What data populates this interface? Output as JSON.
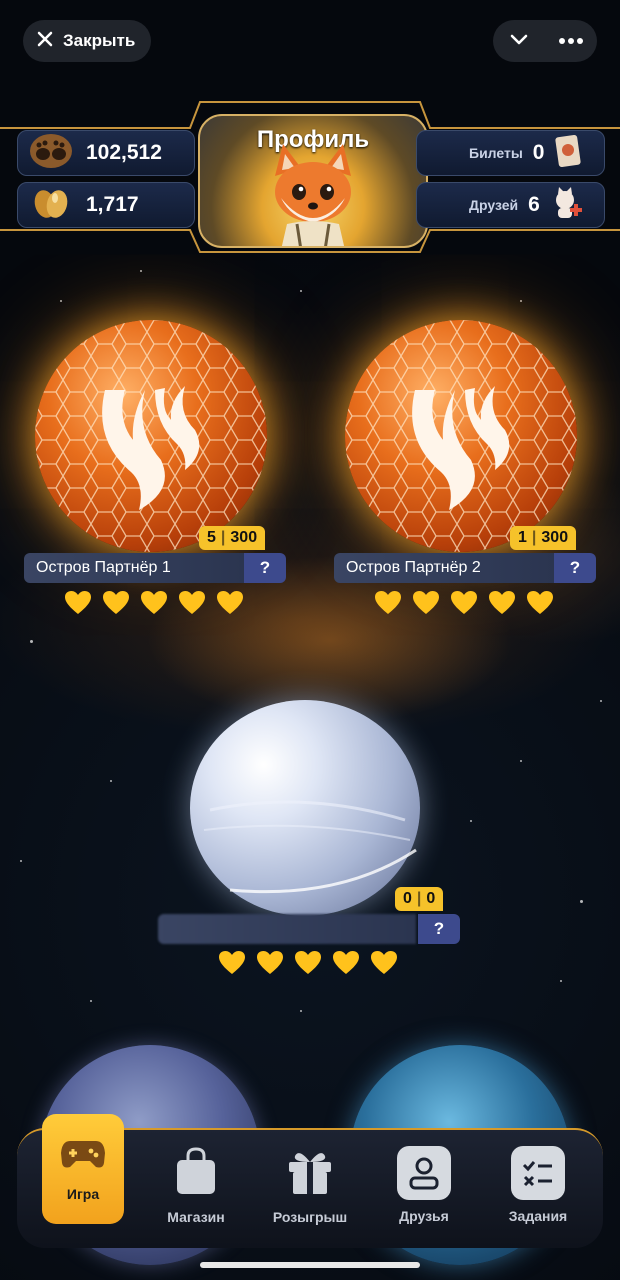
{
  "top_bar": {
    "close_label": "Закрыть"
  },
  "header": {
    "profile_label": "Профиль",
    "paws_value": "102,512",
    "eggs_value": "1,717",
    "tickets_label": "Билеты",
    "tickets_value": "0",
    "friends_label": "Друзей",
    "friends_value": "6"
  },
  "islands": [
    {
      "name": "Остров Партнёр 1",
      "counter_left": "5",
      "counter_right": "300",
      "help": "?"
    },
    {
      "name": "Остров Партнёр 2",
      "counter_left": "1",
      "counter_right": "300",
      "help": "?"
    },
    {
      "name": "",
      "counter_left": "0",
      "counter_right": "0",
      "help": "?"
    }
  ],
  "nav": {
    "game": "Игра",
    "shop": "Магазин",
    "giveaway": "Розыгрыш",
    "friends": "Друзья",
    "tasks": "Задания"
  },
  "colors": {
    "accent_gold": "#f6c22a",
    "nav_active": "#ffcc3a",
    "help_button": "#3d4a8d"
  }
}
